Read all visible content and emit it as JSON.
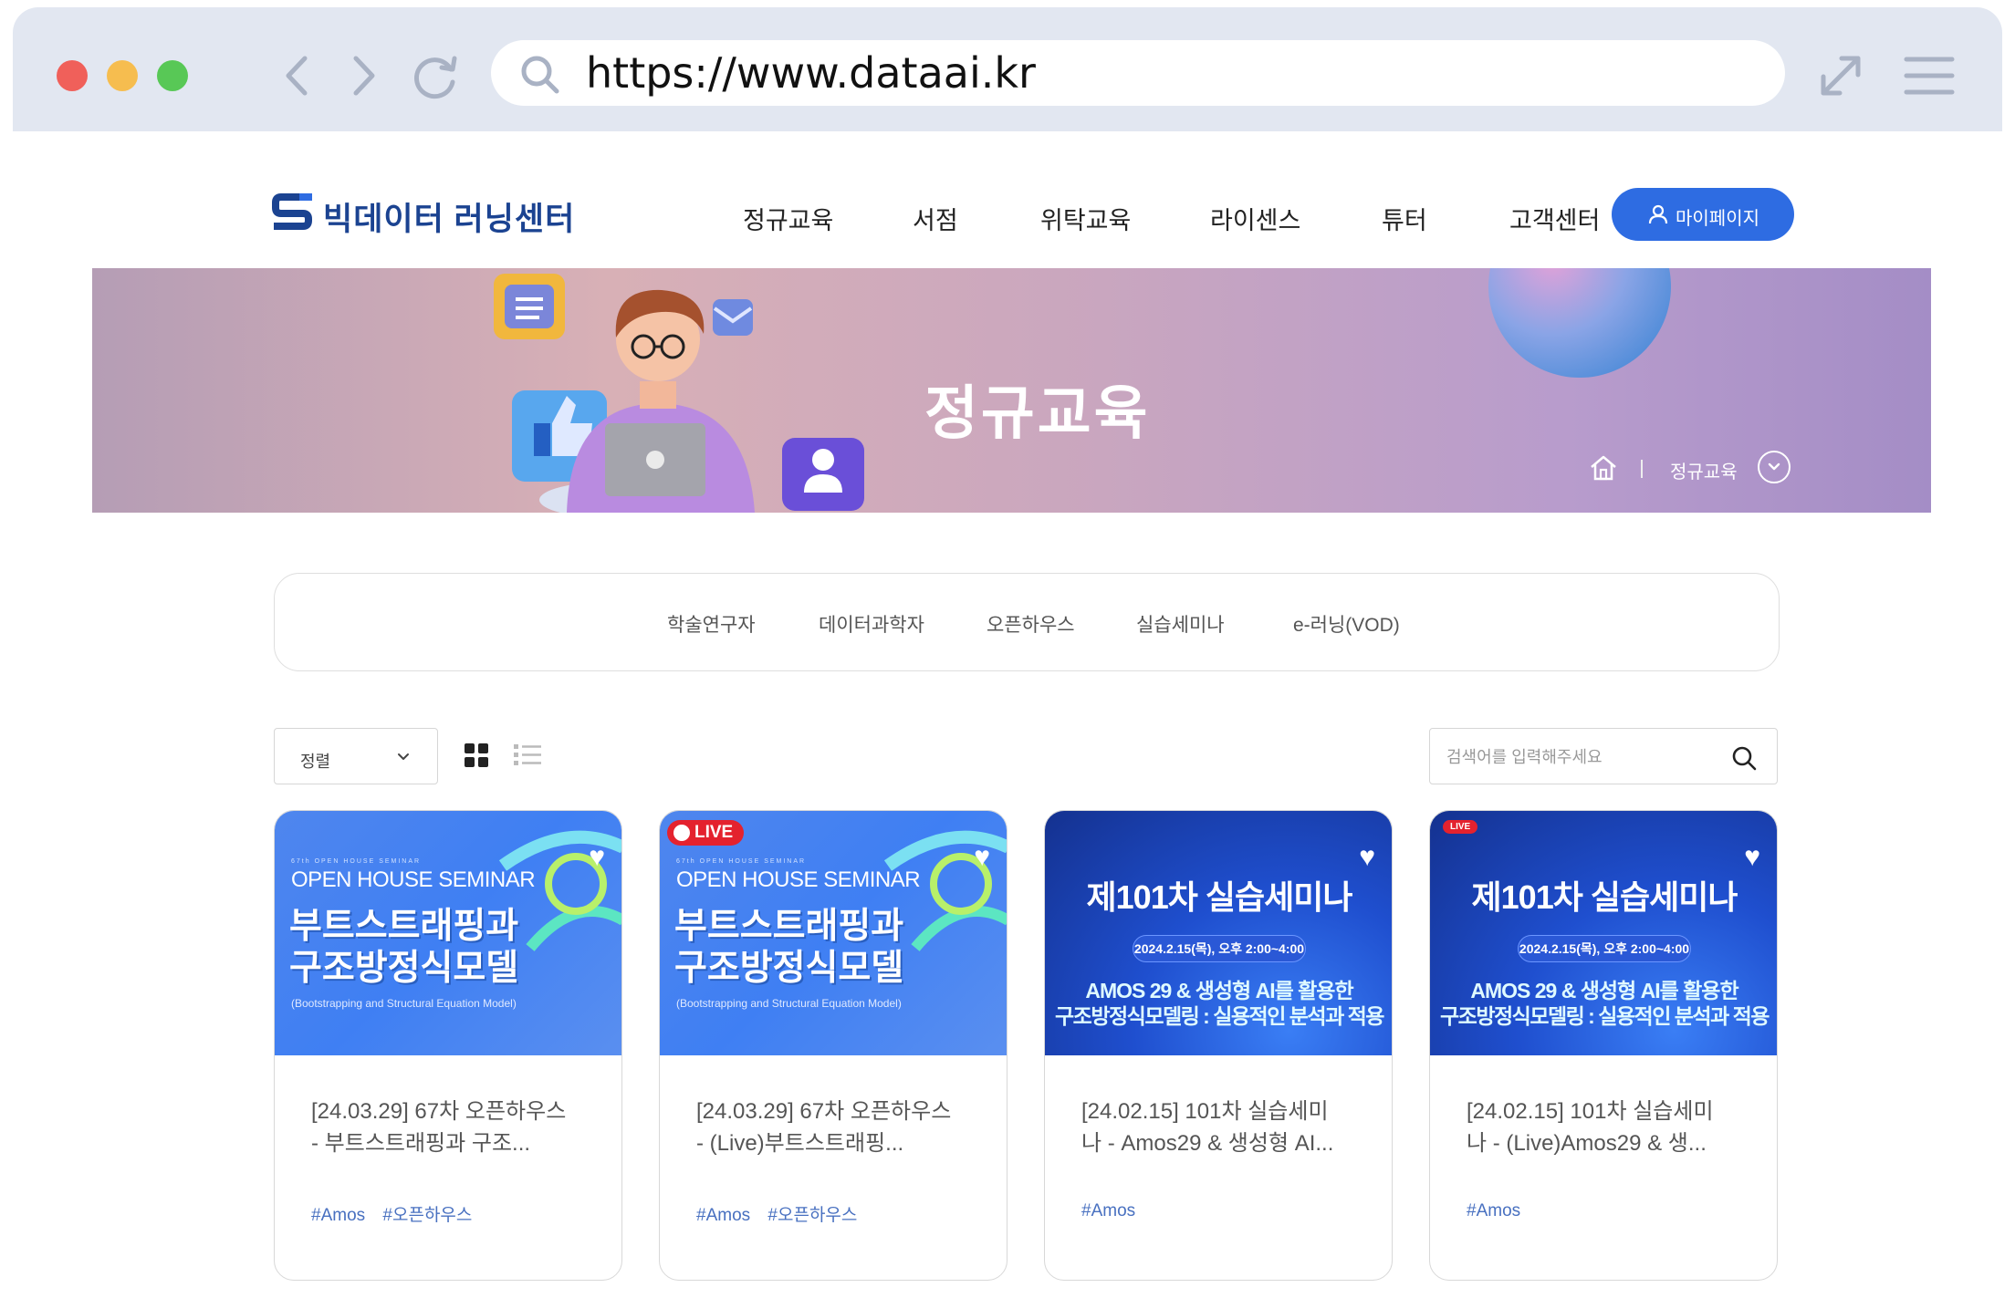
{
  "browser": {
    "url": "https://www.dataai.kr"
  },
  "header": {
    "logo_text": "빅데이터 러닝센터",
    "nav": [
      "정규교육",
      "서점",
      "위탁교육",
      "라이센스",
      "튜터",
      "고객센터"
    ],
    "mypage_label": "마이페이지"
  },
  "hero": {
    "title": "정규교육",
    "breadcrumb": "정규교육"
  },
  "tabs": [
    "학술연구자",
    "데이터과학자",
    "오픈하우스",
    "실습세미나",
    "e-러닝(VOD)"
  ],
  "toolbar": {
    "sort_label": "정렬",
    "search_placeholder": "검색어를 입력해주세요"
  },
  "cards": [
    {
      "thumb": {
        "sub": "67th OPEN HOUSE SEMINAR",
        "head": "OPEN HOUSE SEMINAR",
        "title_1": "부트스트래핑과",
        "title_2": "구조방정식모델",
        "eng": "(Bootstrapping and Structural Equation Model)"
      },
      "title_line1": "[24.03.29] 67차 오픈하우스",
      "title_line2": "- 부트스트래핑과 구조...",
      "tags": [
        "#Amos",
        "#오픈하우스"
      ]
    },
    {
      "thumb": {
        "live": "LIVE",
        "sub": "67th OPEN HOUSE SEMINAR",
        "head": "OPEN HOUSE SEMINAR",
        "title_1": "부트스트래핑과",
        "title_2": "구조방정식모델",
        "eng": "(Bootstrapping and Structural Equation Model)"
      },
      "title_line1": "[24.03.29] 67차 오픈하우스",
      "title_line2": "- (Live)부트스트래핑...",
      "tags": [
        "#Amos",
        "#오픈하우스"
      ]
    },
    {
      "thumb": {
        "title": "제101차 실습세미나",
        "date": "2024.2.15(목), 오후 2:00~4:00",
        "line1": "AMOS 29 & 생성형 AI를 활용한",
        "line2": "구조방정식모델링 : 실용적인 분석과 적용"
      },
      "title_line1": "[24.02.15] 101차 실습세미",
      "title_line2": "나 - Amos29 & 생성형 AI...",
      "tags": [
        "#Amos"
      ]
    },
    {
      "thumb": {
        "live": "LIVE",
        "title": "제101차 실습세미나",
        "date": "2024.2.15(목), 오후 2:00~4:00",
        "line1": "AMOS 29 & 생성형 AI를 활용한",
        "line2": "구조방정식모델링 : 실용적인 분석과 적용"
      },
      "title_line1": "[24.02.15] 101차 실습세미",
      "title_line2": "나 - (Live)Amos29 & 생...",
      "tags": [
        "#Amos"
      ]
    }
  ]
}
